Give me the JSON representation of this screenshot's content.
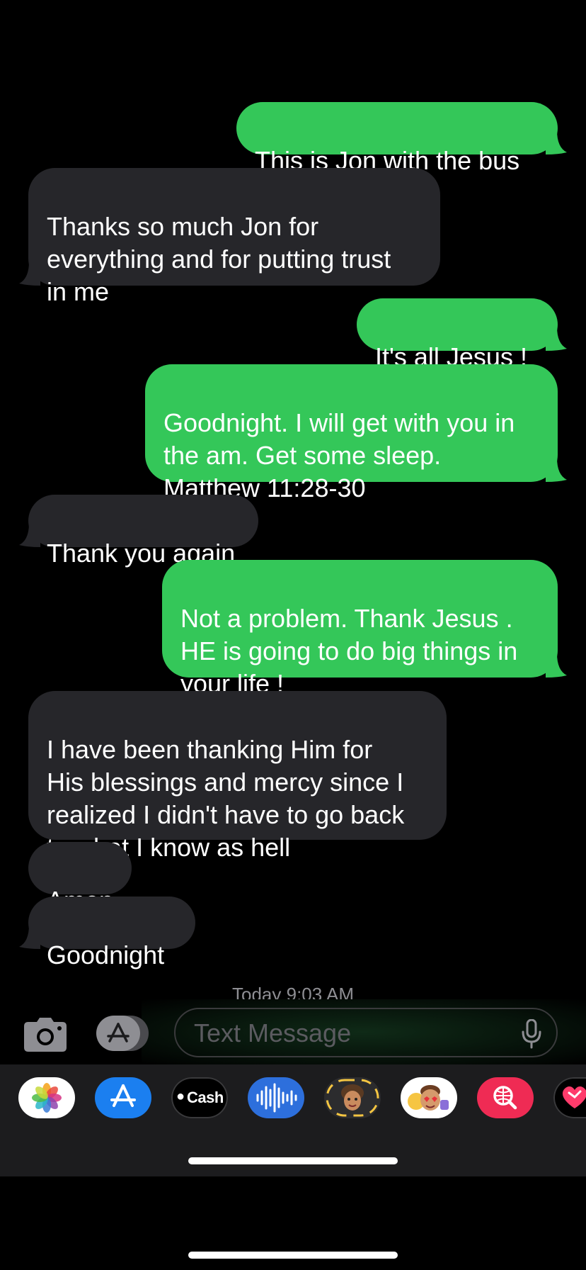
{
  "messages": [
    {
      "from": "me",
      "text": "This is Jon with the bus"
    },
    {
      "from": "them",
      "text": "Thanks so much Jon for\neverything and for putting trust\nin me"
    },
    {
      "from": "me",
      "text": "It's all Jesus !"
    },
    {
      "from": "me",
      "text": "Goodnight. I will get with you in\nthe am. Get some sleep.\nMatthew 11:28-30"
    },
    {
      "from": "them",
      "text": "Thank you again"
    },
    {
      "from": "me",
      "text": "Not a problem. Thank Jesus .\nHE is going to do big things in\nyour life !"
    },
    {
      "from": "them",
      "text": "I have been thanking Him for\nHis blessings and mercy since I\nrealized I didn't have to go back\nto what I know as hell"
    },
    {
      "from": "them",
      "text": "Amen"
    },
    {
      "from": "them",
      "text": "Goodnight"
    }
  ],
  "timestamp": "Today 9:03 AM",
  "composer": {
    "placeholder": "Text Message",
    "camera_icon": "camera-icon",
    "apps_icon": "app-store-icon",
    "mic_icon": "microphone-icon"
  },
  "app_drawer": [
    {
      "name": "photos-app-icon",
      "label": ""
    },
    {
      "name": "app-store-app-icon",
      "label": ""
    },
    {
      "name": "apple-cash-app-icon",
      "label": "Cash"
    },
    {
      "name": "audio-message-app-icon",
      "label": ""
    },
    {
      "name": "memoji-app-icon",
      "label": ""
    },
    {
      "name": "memoji-stickers-app-icon",
      "label": ""
    },
    {
      "name": "web-image-search-app-icon",
      "label": ""
    },
    {
      "name": "digital-touch-app-icon",
      "label": ""
    }
  ],
  "colors": {
    "sent_bubble": "#34c759",
    "received_bubble": "#26262a",
    "background": "#000000",
    "drawer": "#1c1c1e"
  }
}
